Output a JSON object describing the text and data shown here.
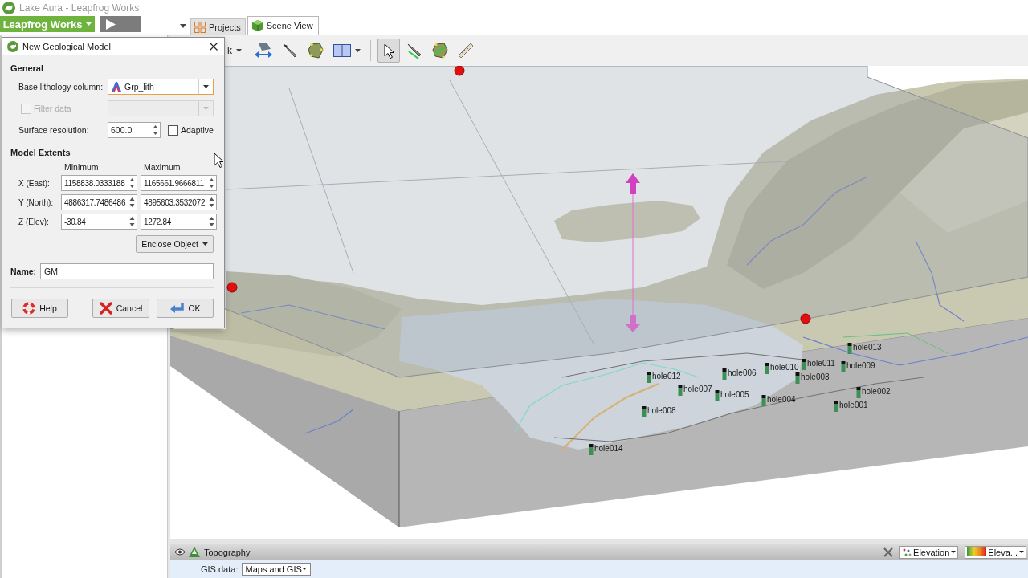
{
  "window": {
    "title": "Lake Aura - Leapfrog Works"
  },
  "app_menu": {
    "label": "Leapfrog Works"
  },
  "tabs": [
    {
      "label": "Projects",
      "selected": false
    },
    {
      "label": "Scene View",
      "selected": true
    }
  ],
  "toolbar": {
    "menu": "k",
    "tools": [
      {
        "selected": false
      },
      {
        "selected": false
      },
      {
        "selected": false
      },
      {
        "selected": false
      },
      {
        "selected": true
      },
      {
        "selected": false
      },
      {
        "selected": false
      },
      {
        "selected": false
      }
    ]
  },
  "dialog": {
    "title": "New Geological Model",
    "general": {
      "heading": "General",
      "base_lithology": {
        "label": "Base lithology column:",
        "value": "Grp_lith",
        "focused": true
      },
      "filter": {
        "label": "Filter data",
        "checked": false,
        "disabled": true
      },
      "filter_column": {
        "disabled": true
      },
      "resolution": {
        "label": "Surface resolution:",
        "value": "600.0"
      },
      "adaptive": {
        "label": "Adaptive",
        "checked": false,
        "disabled": false
      }
    },
    "extents": {
      "heading": "Model Extents",
      "columns": [
        "Minimum",
        "Maximum"
      ],
      "rows": [
        {
          "label": "X (East):",
          "minimum": "1158838.0333188",
          "maximum": "1165661.9666811"
        },
        {
          "label": "Y (North):",
          "minimum": "4886317.7486486",
          "maximum": "4895603.3532072"
        },
        {
          "label": "Z (Elev):",
          "minimum": "-30.84",
          "maximum": "1272.84"
        }
      ],
      "enclose_button": "Enclose Object"
    },
    "name": {
      "label": "Name:",
      "value": "GM"
    },
    "buttons": [
      "Help",
      "Cancel",
      "OK"
    ]
  },
  "scene": {
    "drillholes": [
      {
        "label": "hole013"
      },
      {
        "label": "hole011"
      },
      {
        "label": "hole010"
      },
      {
        "label": "hole009"
      },
      {
        "label": "hole006"
      },
      {
        "label": "hole003"
      },
      {
        "label": "hole012"
      },
      {
        "label": "hole007"
      },
      {
        "label": "hole005"
      },
      {
        "label": "hole002"
      },
      {
        "label": "hole004"
      },
      {
        "label": "hole001"
      },
      {
        "label": "hole008"
      },
      {
        "label": "hole014"
      }
    ]
  },
  "layer_panel": {
    "name": "Topography",
    "visible": true,
    "display_menu": "Elevation",
    "colormap_menu": "Eleva...",
    "gis_label": "GIS data:",
    "gis_value": "Maps and GIS"
  }
}
